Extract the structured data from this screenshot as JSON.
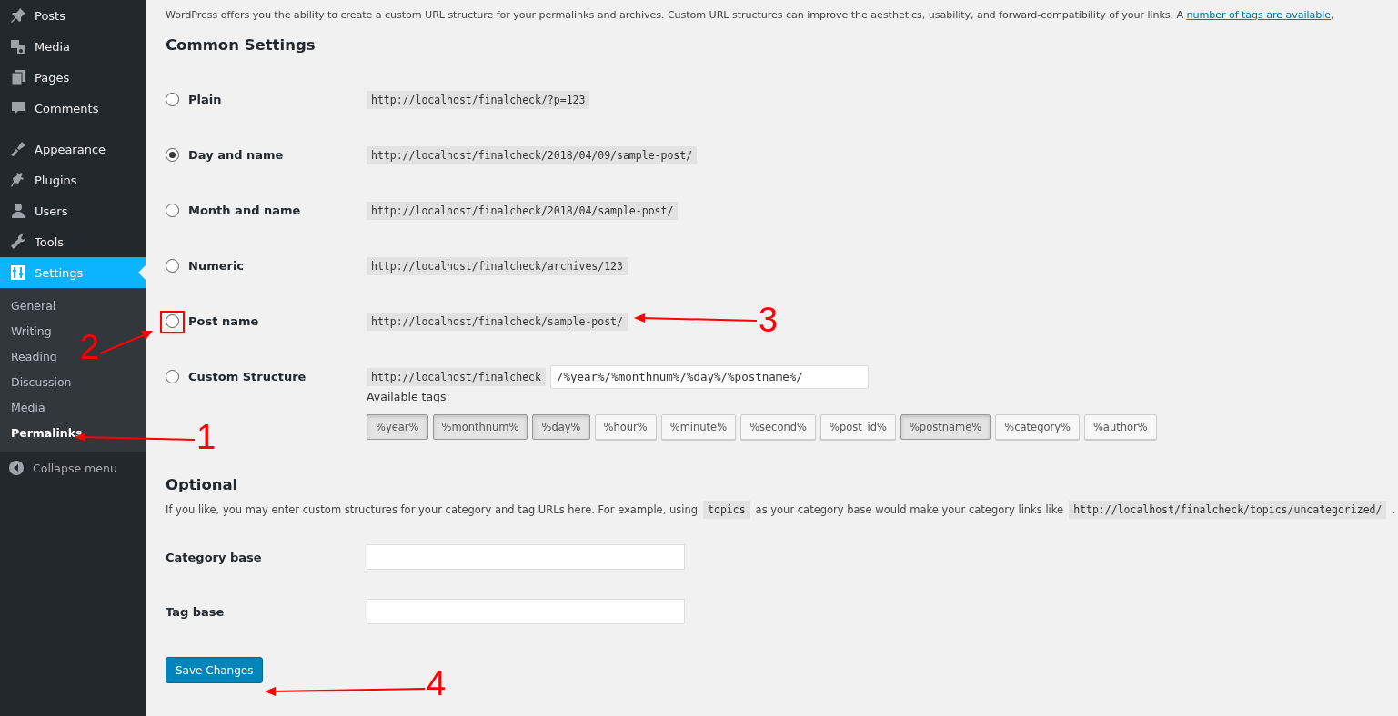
{
  "sidebar": {
    "items": [
      {
        "label": "Posts",
        "selected": false
      },
      {
        "label": "Media",
        "selected": false
      },
      {
        "label": "Pages",
        "selected": false
      },
      {
        "label": "Comments",
        "selected": false
      },
      {
        "label": "Appearance",
        "selected": false
      },
      {
        "label": "Plugins",
        "selected": false
      },
      {
        "label": "Users",
        "selected": false
      },
      {
        "label": "Tools",
        "selected": false
      },
      {
        "label": "Settings",
        "selected": true
      }
    ],
    "submenu": [
      {
        "label": "General",
        "selected": false
      },
      {
        "label": "Writing",
        "selected": false
      },
      {
        "label": "Reading",
        "selected": false
      },
      {
        "label": "Discussion",
        "selected": false
      },
      {
        "label": "Media",
        "selected": false
      },
      {
        "label": "Permalinks",
        "selected": true
      }
    ],
    "collapse": "Collapse menu"
  },
  "intro": {
    "text": "WordPress offers you the ability to create a custom URL structure for your permalinks and archives. Custom URL structures can improve the aesthetics, usability, and forward-compatibility of your links. A ",
    "link": "number of tags are available",
    "after": ","
  },
  "common": {
    "title": "Common Settings",
    "options": [
      {
        "label": "Plain",
        "url": "http://localhost/finalcheck/?p=123",
        "selected": false,
        "kind": "preset"
      },
      {
        "label": "Day and name",
        "url": "http://localhost/finalcheck/2018/04/09/sample-post/",
        "selected": true,
        "kind": "preset"
      },
      {
        "label": "Month and name",
        "url": "http://localhost/finalcheck/2018/04/sample-post/",
        "selected": false,
        "kind": "preset"
      },
      {
        "label": "Numeric",
        "url": "http://localhost/finalcheck/archives/123",
        "selected": false,
        "kind": "preset"
      },
      {
        "label": "Post name",
        "url": "http://localhost/finalcheck/sample-post/",
        "selected": false,
        "kind": "preset"
      },
      {
        "label": "Custom Structure",
        "url": "http://localhost/finalcheck",
        "value": "/%year%/%monthnum%/%day%/%postname%/",
        "selected": false,
        "kind": "custom"
      }
    ],
    "tags_label": "Available tags:",
    "tags": [
      {
        "label": "%year%",
        "selected": true
      },
      {
        "label": "%monthnum%",
        "selected": true
      },
      {
        "label": "%day%",
        "selected": true
      },
      {
        "label": "%hour%",
        "selected": false
      },
      {
        "label": "%minute%",
        "selected": false
      },
      {
        "label": "%second%",
        "selected": false
      },
      {
        "label": "%post_id%",
        "selected": false
      },
      {
        "label": "%postname%",
        "selected": true
      },
      {
        "label": "%category%",
        "selected": false
      },
      {
        "label": "%author%",
        "selected": false
      }
    ]
  },
  "optional": {
    "title": "Optional",
    "parts": [
      {
        "kind": "text",
        "text": "If you like, you may enter custom structures for your category and tag URLs here. For example, using"
      },
      {
        "kind": "code",
        "text": "topics"
      },
      {
        "kind": "text",
        "text": "as your category base would make your category links like"
      },
      {
        "kind": "code",
        "text": "http://localhost/finalcheck/topics/uncategorized/"
      },
      {
        "kind": "text",
        "text": "."
      }
    ],
    "fields": [
      {
        "label": "Category base"
      },
      {
        "label": "Tag base"
      }
    ]
  },
  "save": "Save Changes",
  "annotations": [
    {
      "number": "1"
    },
    {
      "number": "2"
    },
    {
      "number": "3"
    },
    {
      "number": "4"
    }
  ]
}
